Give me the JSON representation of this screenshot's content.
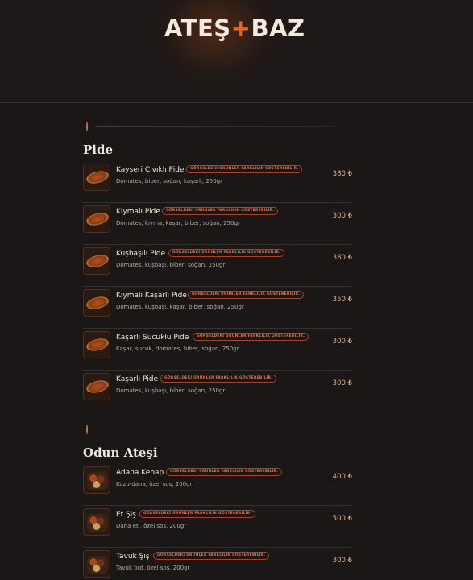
{
  "brand": {
    "left": "ATEŞ",
    "plus": "+",
    "right": "BAZ"
  },
  "currency": "₺",
  "badge_text": "GÖRSELDEKİ ÜRÜNLER FARKLILIK GÖSTEREBİLİR.",
  "sections": [
    {
      "title": "Pide",
      "items": [
        {
          "name": "Kayseri Cıvıklı Pide",
          "desc": "Domates, biber, soğan, kaşarlı, 250gr",
          "price": "380 ₺",
          "image": "pide-image"
        },
        {
          "name": "Kıymalı Pide",
          "desc": "Domates, kıyma, kaşar, biber, soğan, 250gr",
          "price": "300 ₺",
          "image": "pide-image"
        },
        {
          "name": "Kuşbaşılı Pide",
          "desc": "Domates, kuşbaşı, biber, soğan, 250gr",
          "price": "380 ₺",
          "image": "pide-image"
        },
        {
          "name": "Kıymalı Kaşarlı Pide",
          "desc": "Domates, kuşbaşı, kaşar, biber, soğan, 250gr",
          "price": "350 ₺",
          "image": "pide-image"
        },
        {
          "name": "Kaşarlı Sucuklu Pide",
          "desc": "Kaşar, sucuk, domates, biber, soğan, 250gr",
          "price": "300 ₺",
          "image": "pide-image"
        },
        {
          "name": "Kaşarlı Pide",
          "desc": "Domates, kuşbaşı, biber, soğan, 250gr",
          "price": "300 ₺",
          "image": "pide-image"
        }
      ]
    },
    {
      "title": "Odun Ateşi",
      "items": [
        {
          "name": "Adana Kebap",
          "desc": "Kuzu-dana, özel sos, 200gr",
          "price": "400 ₺",
          "image": "kebab-plate-image"
        },
        {
          "name": "Et Şiş",
          "desc": "Dana eti, özel sos, 200gr",
          "price": "500 ₺",
          "image": "kebab-plate-image"
        },
        {
          "name": "Tavuk Şiş",
          "desc": "Tavuk but, özel sos, 200gr",
          "price": "300 ₺",
          "image": "kebab-plate-image"
        }
      ]
    }
  ]
}
